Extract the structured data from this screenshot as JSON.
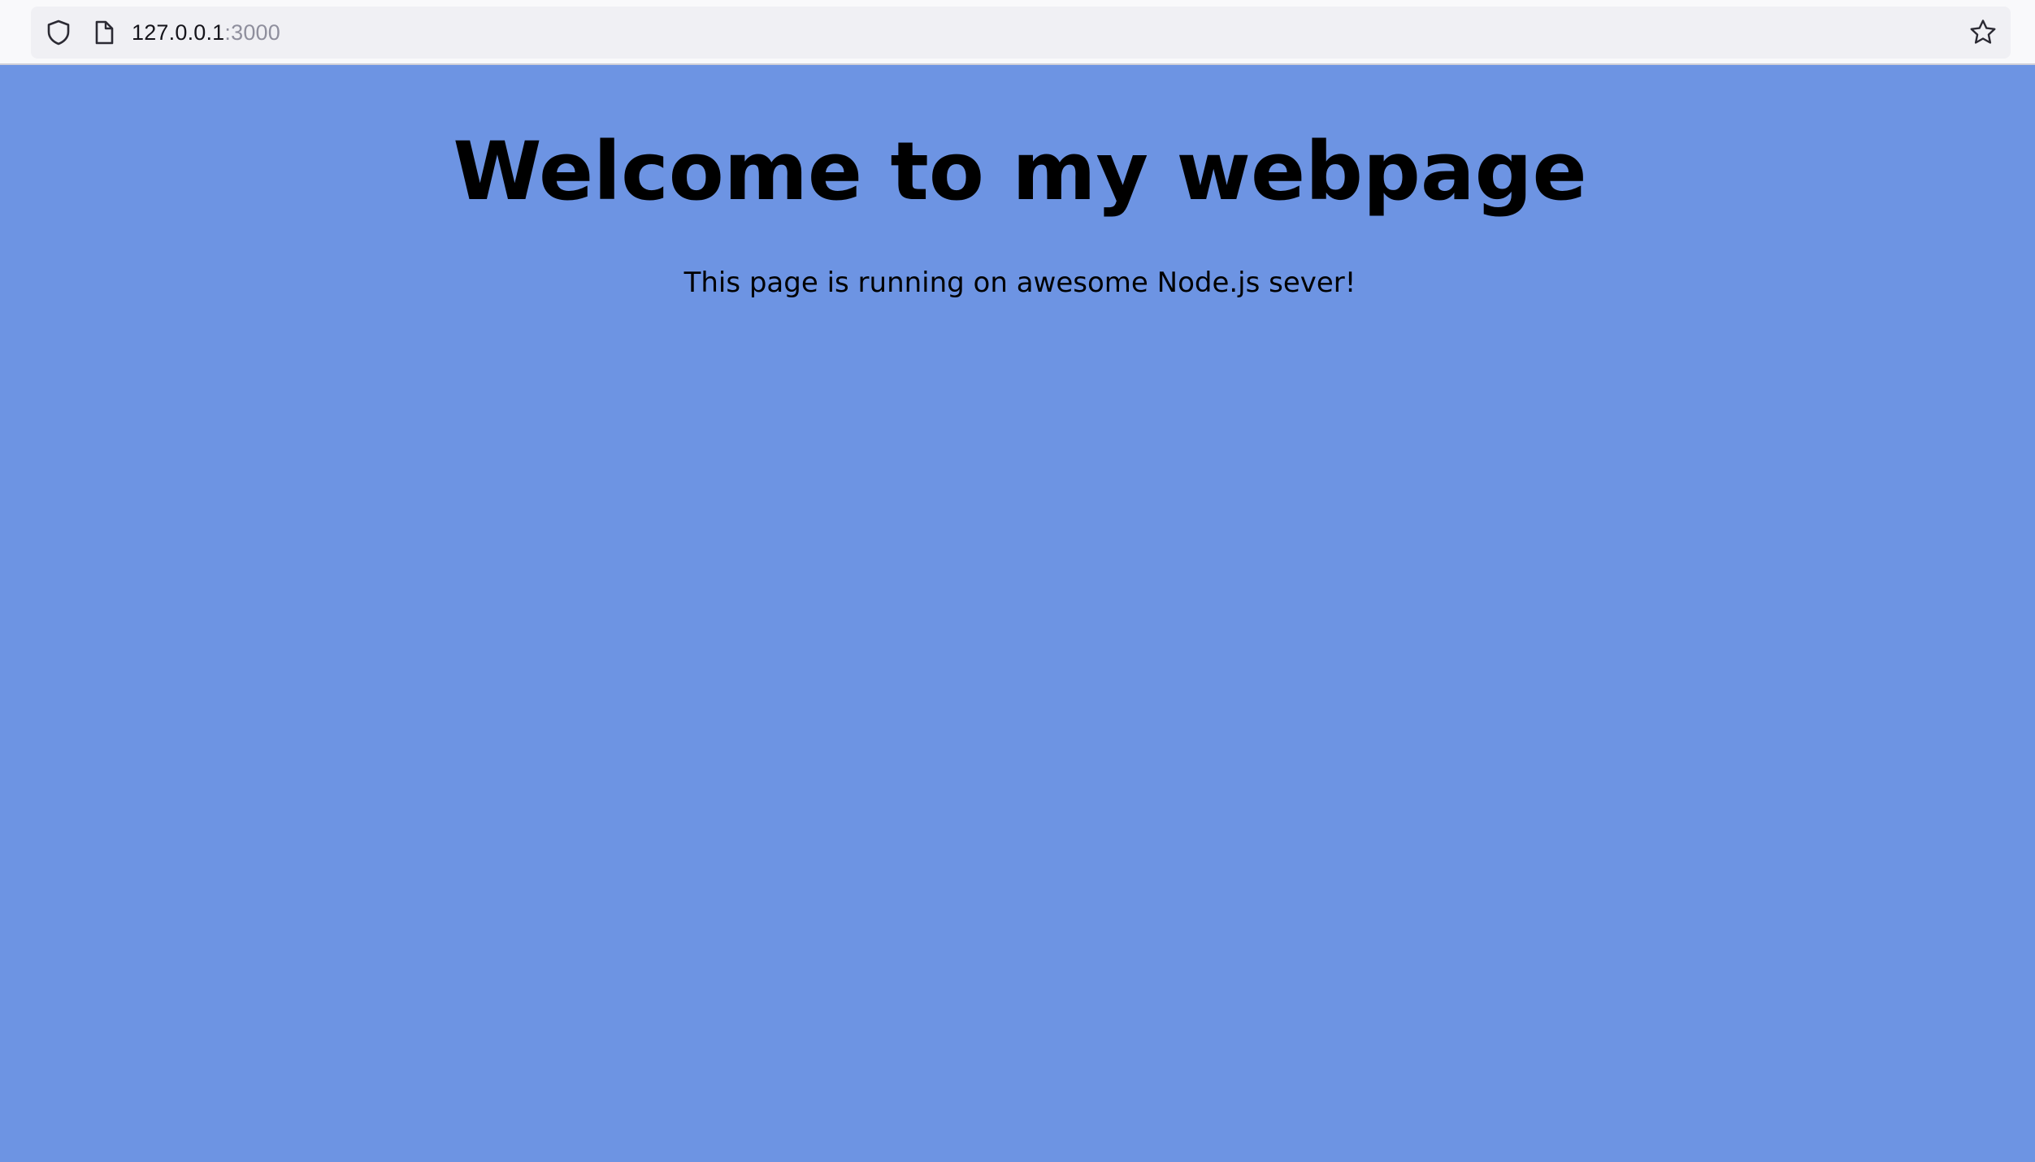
{
  "browser": {
    "url_host": "127.0.0.1",
    "url_port": ":3000",
    "icons": {
      "site_security": "shield-icon",
      "page_type": "page-icon",
      "bookmark": "star-icon"
    },
    "colors": {
      "toolbar": "#f9f9fb",
      "url_bar": "#f0f0f4"
    }
  },
  "page": {
    "heading": "Welcome to my webpage",
    "message": "This page is running on awesome Node.js sever!",
    "colors": {
      "background": "#6d94e3",
      "text": "#000000"
    }
  }
}
